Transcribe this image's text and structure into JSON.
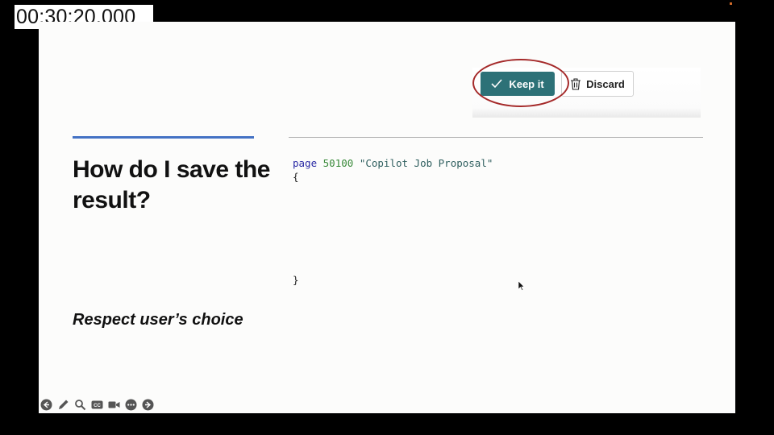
{
  "timestamp": "00:30:20.000",
  "slide": {
    "title": "How do I save the result?",
    "subtitle": "Respect user’s choice",
    "buttons": {
      "keep_label": "Keep it",
      "discard_label": "Discard"
    },
    "code": {
      "keyword": "page",
      "id": "50100",
      "name": "\"Copilot Job Proposal\"",
      "open_brace": "{",
      "close_brace": "}"
    }
  },
  "colors": {
    "accent": "#4472c4",
    "keep_button": "#2d7177",
    "highlight_ring": "#a52a2a"
  },
  "controls": [
    "previous-icon",
    "pen-icon",
    "zoom-icon",
    "captions-icon",
    "video-icon",
    "more-icon",
    "next-icon"
  ]
}
